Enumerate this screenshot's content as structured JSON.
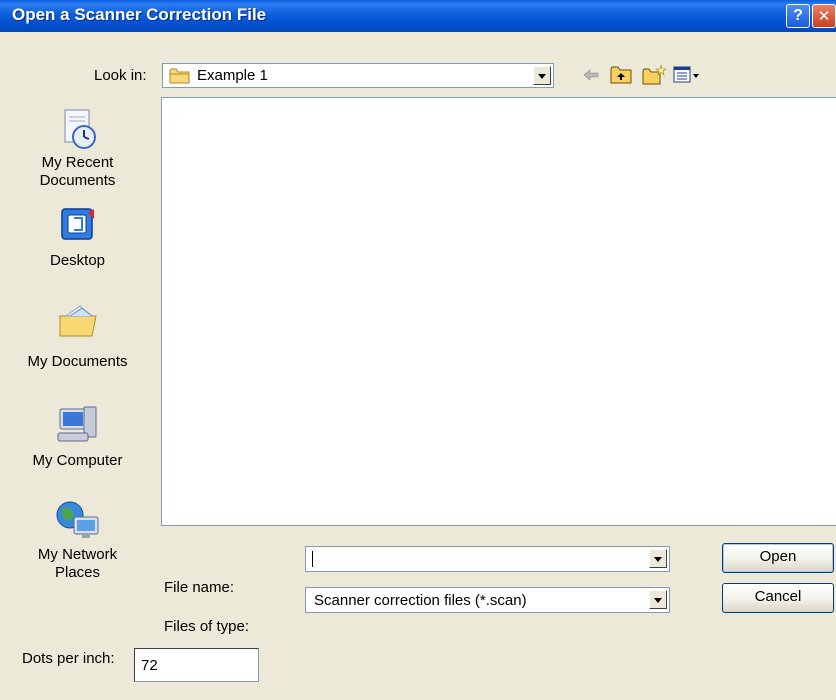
{
  "window": {
    "title": "Open a Scanner Correction File",
    "help_label": "?",
    "close_label": "✕"
  },
  "lookin": {
    "label": "Look in:",
    "value": "Example 1",
    "icon": "folder-icon"
  },
  "toolbar": {
    "icons": [
      "back-arrow-icon",
      "up-one-level-icon",
      "create-new-folder-icon",
      "view-menu-icon"
    ]
  },
  "places": [
    {
      "label": "My Recent\nDocuments",
      "icon": "recent-documents-icon"
    },
    {
      "label": "Desktop",
      "icon": "desktop-icon"
    },
    {
      "label": "My Documents",
      "icon": "my-documents-icon"
    },
    {
      "label": "My Computer",
      "icon": "my-computer-icon"
    },
    {
      "label": "My Network\nPlaces",
      "icon": "network-places-icon"
    }
  ],
  "file_name": {
    "label": "File name:",
    "value": ""
  },
  "file_type": {
    "label": "Files of type:",
    "value": "Scanner correction files (*.scan)"
  },
  "buttons": {
    "open": "Open",
    "cancel": "Cancel"
  },
  "dpi": {
    "label": "Dots per inch:",
    "value": "72"
  },
  "colors": {
    "titlebar": "#0350d0",
    "dialog_bg": "#ece9d8",
    "field_border": "#7f9db9"
  }
}
